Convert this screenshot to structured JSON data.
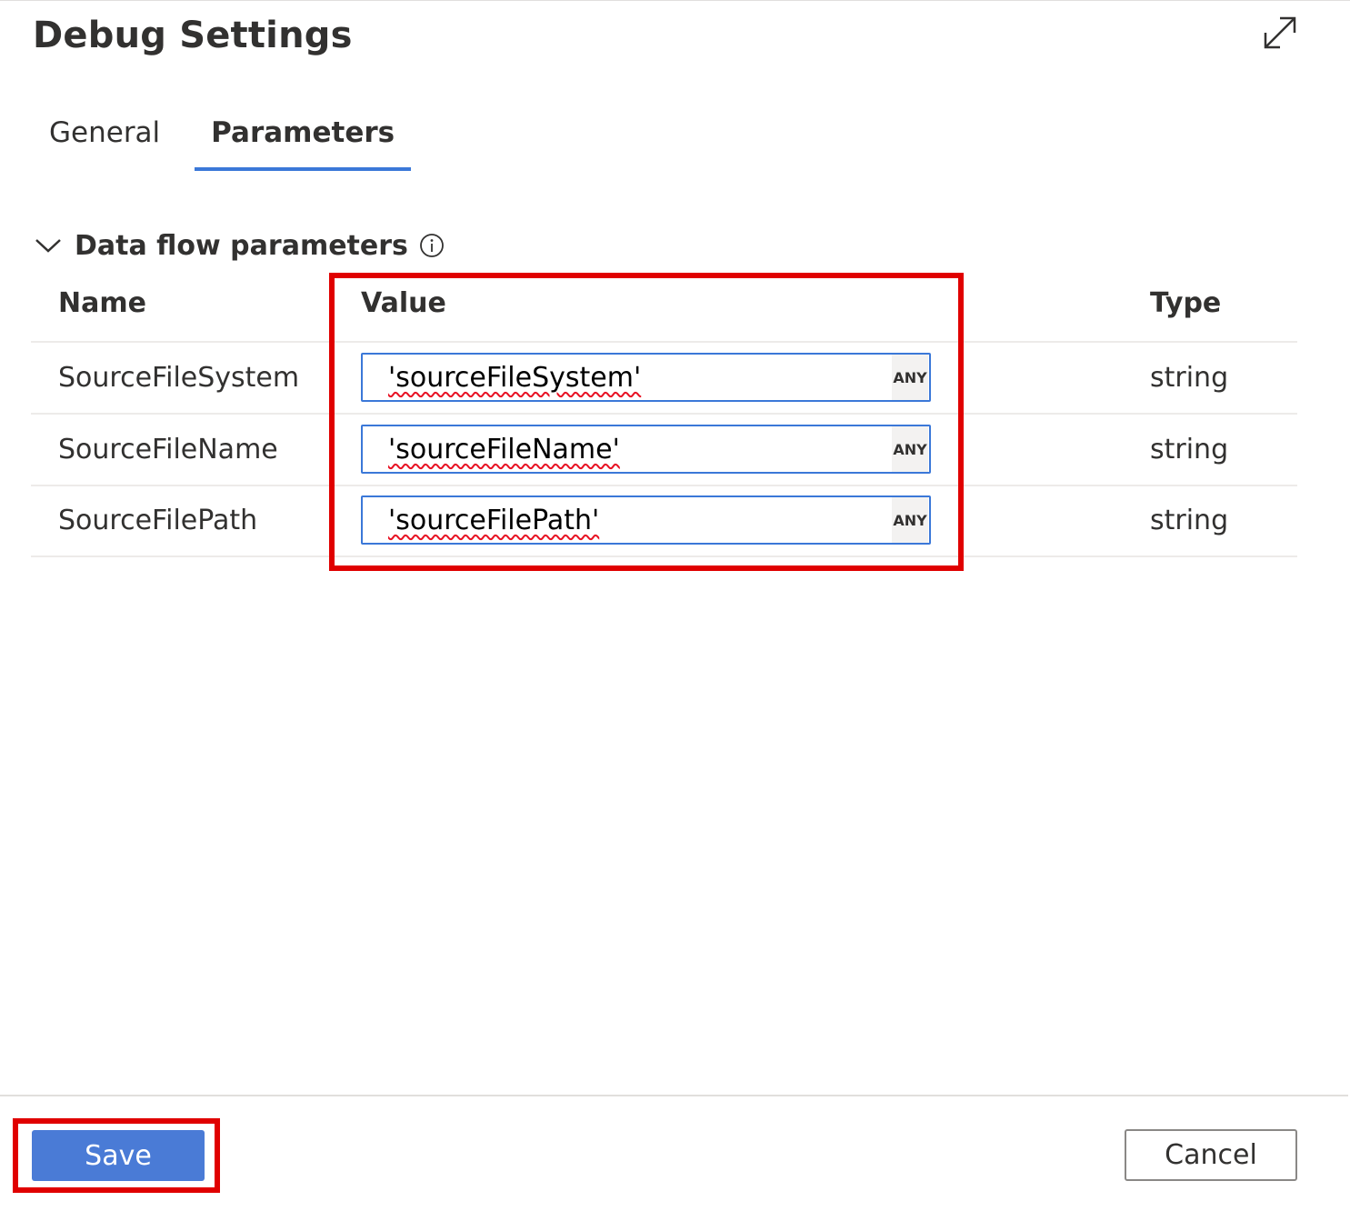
{
  "dialog": {
    "title": "Debug Settings",
    "expand_icon": "expand-diagonal-arrow-icon"
  },
  "tabs": [
    {
      "label": "General",
      "active": false
    },
    {
      "label": "Parameters",
      "active": true
    }
  ],
  "section": {
    "title": "Data flow parameters",
    "collapse_icon": "chevron-down-icon",
    "info_icon": "info-icon",
    "expanded": true
  },
  "table": {
    "columns": [
      "Name",
      "Value",
      "Type"
    ],
    "rows": [
      {
        "name": "SourceFileSystem",
        "value": "'sourceFileSystem'",
        "badge": "ANY",
        "type": "string"
      },
      {
        "name": "SourceFileName",
        "value": "'sourceFileName'",
        "badge": "ANY",
        "type": "string"
      },
      {
        "name": "SourceFilePath",
        "value": "'sourceFilePath'",
        "badge": "ANY",
        "type": "string"
      }
    ]
  },
  "footer": {
    "save_label": "Save",
    "cancel_label": "Cancel"
  },
  "colors": {
    "accent": "#3b78d8",
    "save_button": "#4a7bd6",
    "highlight": "#e00000",
    "spellcheck_underline": "#e81123"
  }
}
